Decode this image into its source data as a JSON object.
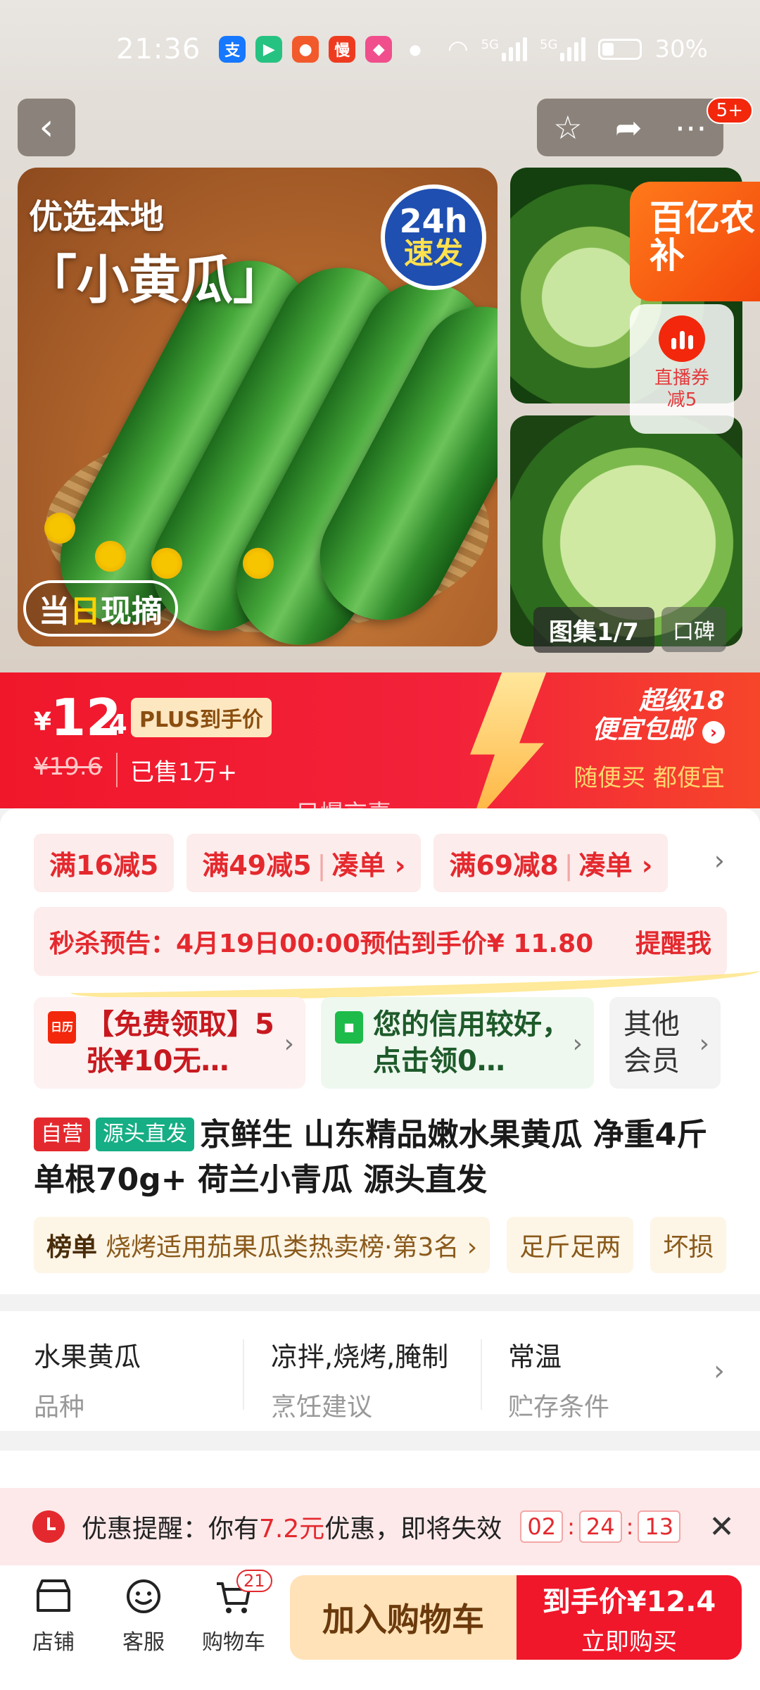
{
  "status": {
    "time": "21:36",
    "battery": "30%",
    "net1": "5G",
    "net2": "5G"
  },
  "header": {
    "message_badge": "5+"
  },
  "gallery": {
    "main_title_1": "优选本地",
    "main_title_2": "「小黄瓜」",
    "badge_line1": "24h",
    "badge_line2": "速发",
    "pick_label_1": "当",
    "pick_label_2": "日",
    "pick_label_3": "现摘",
    "counter": "图集1/7",
    "koubei": "口碑",
    "subsidy": "百亿农补",
    "live_coupon_1": "直播券",
    "live_coupon_2": "减5"
  },
  "price": {
    "currency": "¥",
    "integer": "12",
    "decimal": ".4",
    "plus_label": "PLUS到手价",
    "original": "¥19.6",
    "sold": "已售1万+",
    "super18_line1": "超级18",
    "super18_line2": "便宜包邮",
    "slogan": "随便买 都便宜",
    "watermark": "只爆京喜"
  },
  "promos": [
    {
      "main": "满16减5",
      "extra": ""
    },
    {
      "main": "满49减5",
      "extra": "凑单 ›"
    },
    {
      "main": "满69减8",
      "extra": "凑单 ›"
    }
  ],
  "flash": {
    "text": "秒杀预告：4月19日00:00预估到手价¥ 11.80",
    "action": "提醒我"
  },
  "benefits": [
    {
      "text": "【免费领取】5张¥10无…",
      "icon": "日历"
    },
    {
      "text": "您的信用较好，点击领0…",
      "icon": ""
    },
    {
      "text": "其他会员",
      "icon": ""
    }
  ],
  "product": {
    "tag_self": "自营",
    "tag_source": "源头直发",
    "title": "京鲜生 山东精品嫩水果黄瓜 净重4斤 单根70g+ 荷兰小青瓜 源头直发"
  },
  "chips": [
    {
      "label": "榜单",
      "text": "烧烤适用茄果瓜类热卖榜·第3名 ›"
    },
    {
      "label": "",
      "text": "足斤足两"
    },
    {
      "label": "",
      "text": "坏损"
    }
  ],
  "attributes": [
    {
      "value": "水果黄瓜",
      "key": "品种"
    },
    {
      "value": "凉拌,烧烤,腌制",
      "key": "烹饪建议"
    },
    {
      "value": "常温",
      "key": "贮存条件"
    }
  ],
  "reminder": {
    "prefix": "优惠提醒：你有",
    "amount": "7.2元",
    "suffix": "优惠，即将失效",
    "hh": "02",
    "mm": "24",
    "ss": "13"
  },
  "bottom": {
    "store": "店铺",
    "service": "客服",
    "cart": "购物车",
    "cart_count": "21",
    "add_to_cart": "加入购物车",
    "buy_price": "到手价¥12.4",
    "buy_now": "立即购买"
  },
  "colors": {
    "accent": "#f0172a",
    "promo_bg": "#fdecec",
    "cart_btn_bg": "#ffe2b8"
  }
}
